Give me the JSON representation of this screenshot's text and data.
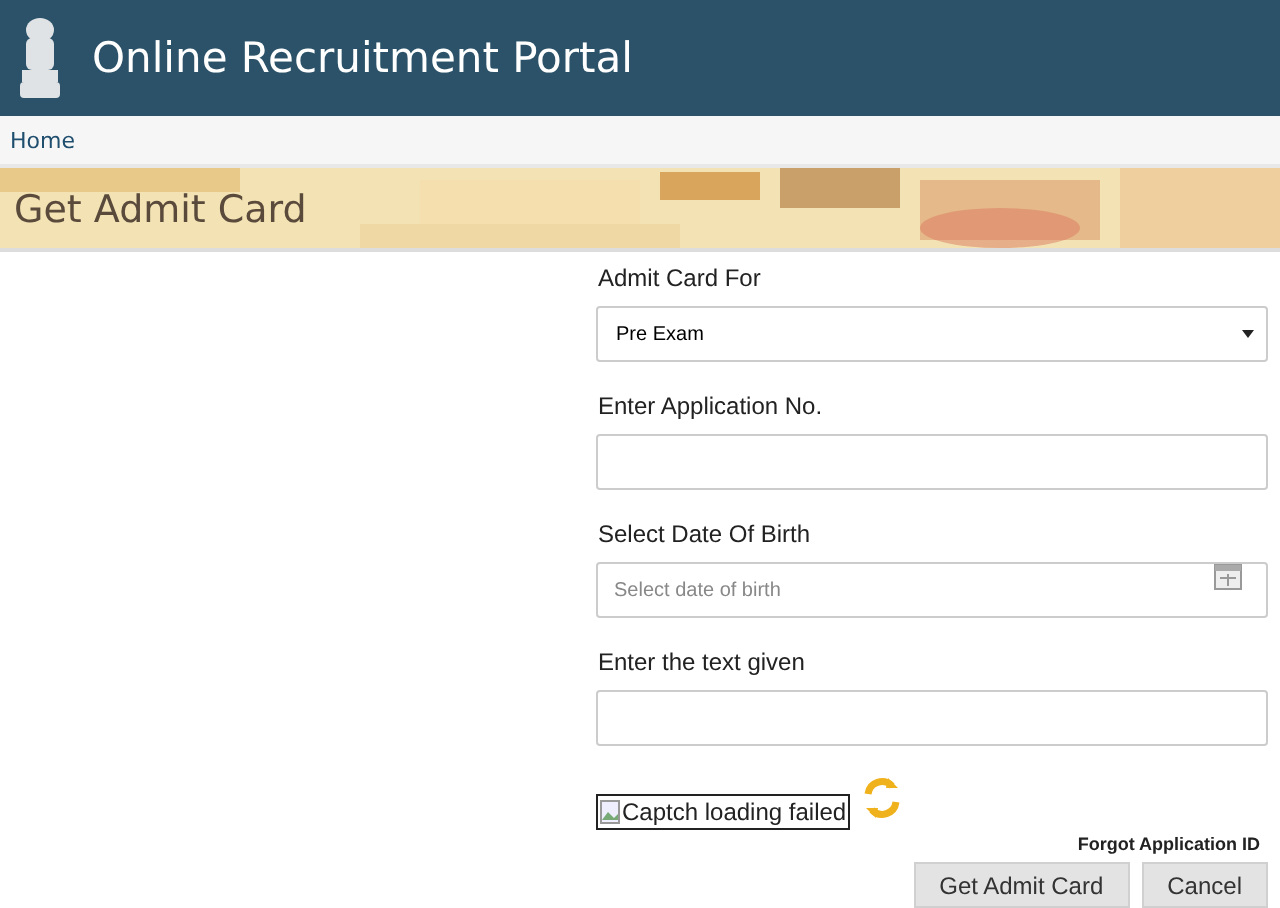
{
  "header": {
    "title": "Online Recruitment Portal"
  },
  "nav": {
    "items": [
      {
        "label": "Home"
      }
    ]
  },
  "banner": {
    "kind": "picture",
    "title": "Get Admit Card"
  },
  "form": {
    "fields": [
      {
        "kind": "select",
        "label": "Admit Card For",
        "value": "Pre Exam"
      },
      {
        "kind": "text",
        "label": "Enter Application No."
      },
      {
        "kind": "date",
        "label": "Select Date Of Birth",
        "placeholder": "Select date of birth"
      },
      {
        "kind": "text",
        "label": "Enter the text given"
      }
    ],
    "captcha": {
      "alt": "Captch loading failed"
    },
    "forgot_link": "Forgot Application ID",
    "buttons": [
      "Get Admit Card",
      "Cancel"
    ]
  }
}
